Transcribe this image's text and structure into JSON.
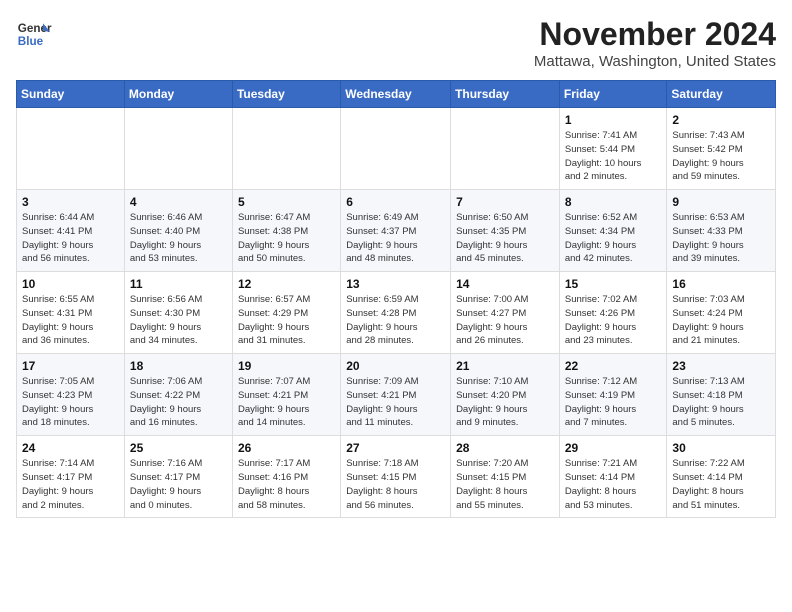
{
  "logo": {
    "line1": "General",
    "line2": "Blue"
  },
  "title": "November 2024",
  "subtitle": "Mattawa, Washington, United States",
  "weekdays": [
    "Sunday",
    "Monday",
    "Tuesday",
    "Wednesday",
    "Thursday",
    "Friday",
    "Saturday"
  ],
  "rows": [
    [
      {
        "day": "",
        "detail": ""
      },
      {
        "day": "",
        "detail": ""
      },
      {
        "day": "",
        "detail": ""
      },
      {
        "day": "",
        "detail": ""
      },
      {
        "day": "",
        "detail": ""
      },
      {
        "day": "1",
        "detail": "Sunrise: 7:41 AM\nSunset: 5:44 PM\nDaylight: 10 hours\nand 2 minutes."
      },
      {
        "day": "2",
        "detail": "Sunrise: 7:43 AM\nSunset: 5:42 PM\nDaylight: 9 hours\nand 59 minutes."
      }
    ],
    [
      {
        "day": "3",
        "detail": "Sunrise: 6:44 AM\nSunset: 4:41 PM\nDaylight: 9 hours\nand 56 minutes."
      },
      {
        "day": "4",
        "detail": "Sunrise: 6:46 AM\nSunset: 4:40 PM\nDaylight: 9 hours\nand 53 minutes."
      },
      {
        "day": "5",
        "detail": "Sunrise: 6:47 AM\nSunset: 4:38 PM\nDaylight: 9 hours\nand 50 minutes."
      },
      {
        "day": "6",
        "detail": "Sunrise: 6:49 AM\nSunset: 4:37 PM\nDaylight: 9 hours\nand 48 minutes."
      },
      {
        "day": "7",
        "detail": "Sunrise: 6:50 AM\nSunset: 4:35 PM\nDaylight: 9 hours\nand 45 minutes."
      },
      {
        "day": "8",
        "detail": "Sunrise: 6:52 AM\nSunset: 4:34 PM\nDaylight: 9 hours\nand 42 minutes."
      },
      {
        "day": "9",
        "detail": "Sunrise: 6:53 AM\nSunset: 4:33 PM\nDaylight: 9 hours\nand 39 minutes."
      }
    ],
    [
      {
        "day": "10",
        "detail": "Sunrise: 6:55 AM\nSunset: 4:31 PM\nDaylight: 9 hours\nand 36 minutes."
      },
      {
        "day": "11",
        "detail": "Sunrise: 6:56 AM\nSunset: 4:30 PM\nDaylight: 9 hours\nand 34 minutes."
      },
      {
        "day": "12",
        "detail": "Sunrise: 6:57 AM\nSunset: 4:29 PM\nDaylight: 9 hours\nand 31 minutes."
      },
      {
        "day": "13",
        "detail": "Sunrise: 6:59 AM\nSunset: 4:28 PM\nDaylight: 9 hours\nand 28 minutes."
      },
      {
        "day": "14",
        "detail": "Sunrise: 7:00 AM\nSunset: 4:27 PM\nDaylight: 9 hours\nand 26 minutes."
      },
      {
        "day": "15",
        "detail": "Sunrise: 7:02 AM\nSunset: 4:26 PM\nDaylight: 9 hours\nand 23 minutes."
      },
      {
        "day": "16",
        "detail": "Sunrise: 7:03 AM\nSunset: 4:24 PM\nDaylight: 9 hours\nand 21 minutes."
      }
    ],
    [
      {
        "day": "17",
        "detail": "Sunrise: 7:05 AM\nSunset: 4:23 PM\nDaylight: 9 hours\nand 18 minutes."
      },
      {
        "day": "18",
        "detail": "Sunrise: 7:06 AM\nSunset: 4:22 PM\nDaylight: 9 hours\nand 16 minutes."
      },
      {
        "day": "19",
        "detail": "Sunrise: 7:07 AM\nSunset: 4:21 PM\nDaylight: 9 hours\nand 14 minutes."
      },
      {
        "day": "20",
        "detail": "Sunrise: 7:09 AM\nSunset: 4:21 PM\nDaylight: 9 hours\nand 11 minutes."
      },
      {
        "day": "21",
        "detail": "Sunrise: 7:10 AM\nSunset: 4:20 PM\nDaylight: 9 hours\nand 9 minutes."
      },
      {
        "day": "22",
        "detail": "Sunrise: 7:12 AM\nSunset: 4:19 PM\nDaylight: 9 hours\nand 7 minutes."
      },
      {
        "day": "23",
        "detail": "Sunrise: 7:13 AM\nSunset: 4:18 PM\nDaylight: 9 hours\nand 5 minutes."
      }
    ],
    [
      {
        "day": "24",
        "detail": "Sunrise: 7:14 AM\nSunset: 4:17 PM\nDaylight: 9 hours\nand 2 minutes."
      },
      {
        "day": "25",
        "detail": "Sunrise: 7:16 AM\nSunset: 4:17 PM\nDaylight: 9 hours\nand 0 minutes."
      },
      {
        "day": "26",
        "detail": "Sunrise: 7:17 AM\nSunset: 4:16 PM\nDaylight: 8 hours\nand 58 minutes."
      },
      {
        "day": "27",
        "detail": "Sunrise: 7:18 AM\nSunset: 4:15 PM\nDaylight: 8 hours\nand 56 minutes."
      },
      {
        "day": "28",
        "detail": "Sunrise: 7:20 AM\nSunset: 4:15 PM\nDaylight: 8 hours\nand 55 minutes."
      },
      {
        "day": "29",
        "detail": "Sunrise: 7:21 AM\nSunset: 4:14 PM\nDaylight: 8 hours\nand 53 minutes."
      },
      {
        "day": "30",
        "detail": "Sunrise: 7:22 AM\nSunset: 4:14 PM\nDaylight: 8 hours\nand 51 minutes."
      }
    ]
  ]
}
